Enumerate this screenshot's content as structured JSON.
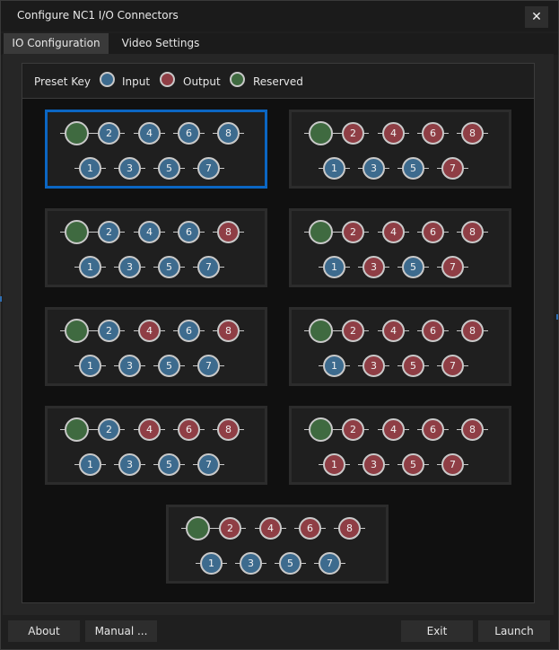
{
  "window": {
    "title": "Configure NC1 I/O Connectors",
    "close_glyph": "✕"
  },
  "tabs": [
    {
      "label": "IO Configuration",
      "active": true
    },
    {
      "label": "Video Settings",
      "active": false
    }
  ],
  "legend": {
    "title": "Preset Key",
    "items": [
      {
        "label": "Input",
        "color": "#3d6b8e"
      },
      {
        "label": "Output",
        "color": "#8f3e45"
      },
      {
        "label": "Reserved",
        "color": "#3f6a40"
      }
    ]
  },
  "colors": {
    "input": "#3d6b8e",
    "output": "#8f3e45",
    "reserved": "#3f6a40",
    "selected_border": "#0b66c3"
  },
  "presets": [
    {
      "selected": true,
      "top": {
        "2": "input",
        "4": "input",
        "6": "input",
        "8": "input"
      },
      "bottom": {
        "1": "input",
        "3": "input",
        "5": "input",
        "7": "input"
      }
    },
    {
      "selected": false,
      "top": {
        "2": "output",
        "4": "output",
        "6": "output",
        "8": "output"
      },
      "bottom": {
        "1": "input",
        "3": "input",
        "5": "input",
        "7": "output"
      }
    },
    {
      "selected": false,
      "top": {
        "2": "input",
        "4": "input",
        "6": "input",
        "8": "output"
      },
      "bottom": {
        "1": "input",
        "3": "input",
        "5": "input",
        "7": "input"
      }
    },
    {
      "selected": false,
      "top": {
        "2": "output",
        "4": "output",
        "6": "output",
        "8": "output"
      },
      "bottom": {
        "1": "input",
        "3": "output",
        "5": "input",
        "7": "output"
      }
    },
    {
      "selected": false,
      "top": {
        "2": "input",
        "4": "output",
        "6": "input",
        "8": "output"
      },
      "bottom": {
        "1": "input",
        "3": "input",
        "5": "input",
        "7": "input"
      }
    },
    {
      "selected": false,
      "top": {
        "2": "output",
        "4": "output",
        "6": "output",
        "8": "output"
      },
      "bottom": {
        "1": "input",
        "3": "output",
        "5": "output",
        "7": "output"
      }
    },
    {
      "selected": false,
      "top": {
        "2": "input",
        "4": "output",
        "6": "output",
        "8": "output"
      },
      "bottom": {
        "1": "input",
        "3": "input",
        "5": "input",
        "7": "input"
      }
    },
    {
      "selected": false,
      "top": {
        "2": "output",
        "4": "output",
        "6": "output",
        "8": "output"
      },
      "bottom": {
        "1": "output",
        "3": "output",
        "5": "output",
        "7": "output"
      }
    },
    {
      "selected": false,
      "top": {
        "2": "output",
        "4": "output",
        "6": "output",
        "8": "output"
      },
      "bottom": {
        "1": "input",
        "3": "input",
        "5": "input",
        "7": "input"
      }
    }
  ],
  "footer": {
    "about": "About",
    "manual": "Manual ...",
    "exit": "Exit",
    "launch": "Launch"
  }
}
